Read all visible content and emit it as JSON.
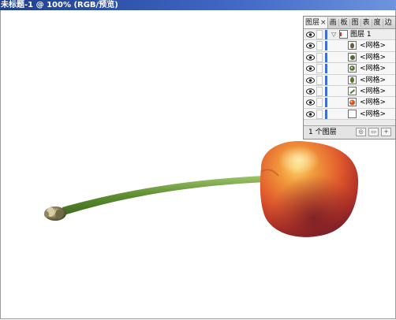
{
  "window": {
    "title": "未标题-1 @ 100% (RGB/预览)"
  },
  "panel": {
    "tabs": [
      {
        "label": "图层",
        "close": "×",
        "active": true
      },
      {
        "label": "画"
      },
      {
        "label": "板"
      },
      {
        "label": "图"
      },
      {
        "label": "表"
      },
      {
        "label": "度"
      },
      {
        "label": "边"
      }
    ],
    "layer": {
      "name": "图层 1",
      "twist_icon": "triangle-down-icon"
    },
    "items": [
      {
        "label": "<网格>",
        "thumb_color": "#6b5a3c"
      },
      {
        "label": "<网格>",
        "thumb_color": "#4f6b2f"
      },
      {
        "label": "<网格>",
        "thumb_color": "#55733a"
      },
      {
        "label": "<网格>",
        "thumb_color": "#58762f"
      },
      {
        "label": "<网格>",
        "thumb_color": "#5e7b34"
      },
      {
        "label": "<网格>",
        "thumb_color": "#d9562a"
      },
      {
        "label": "<网格>",
        "thumb_color": "#ffffff"
      }
    ],
    "footer": {
      "count": "1 个图层",
      "buttons": [
        "locate-object-icon",
        "make-clipping-mask-icon",
        "new-sublayer-icon"
      ]
    }
  },
  "colors": {
    "selection": "#3d6ee0",
    "stem": "#6e9a3e",
    "cherry_light": "#f8b84a",
    "cherry_mid": "#e4582b",
    "cherry_dark": "#7a1f2a"
  }
}
